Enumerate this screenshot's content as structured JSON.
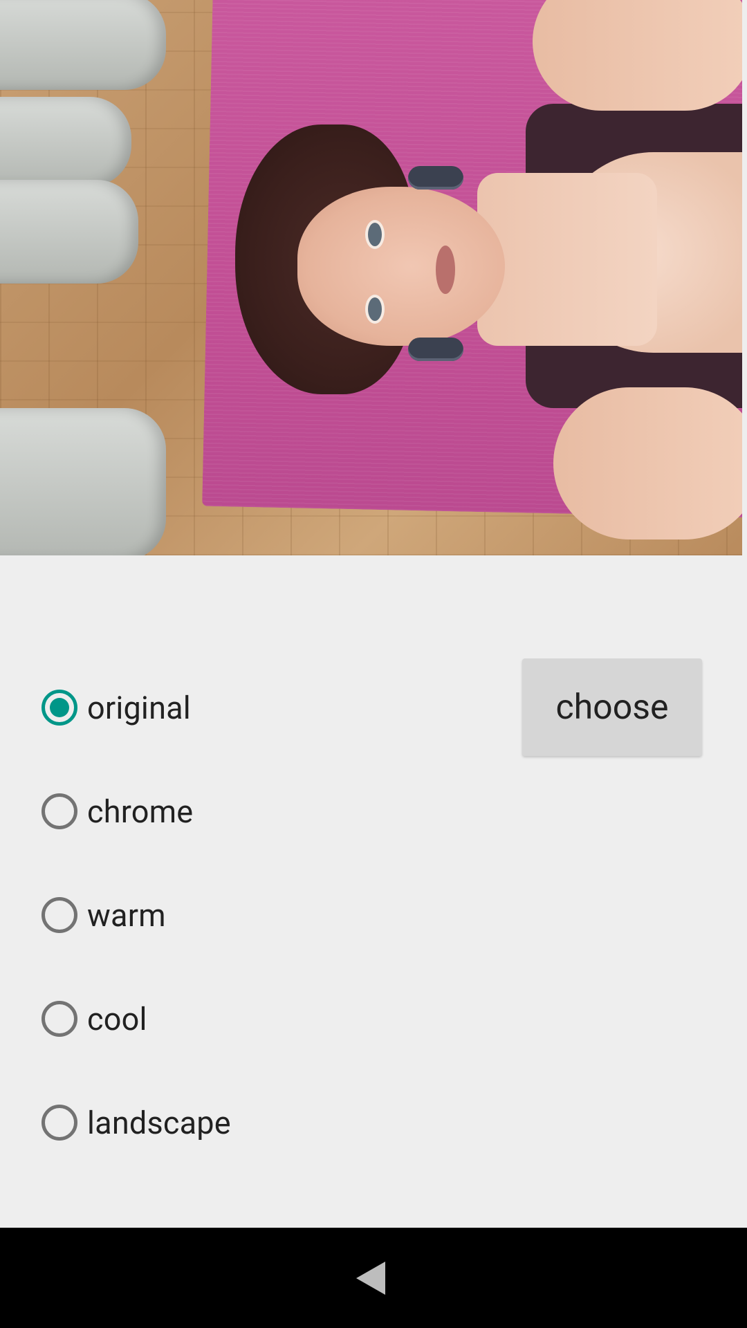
{
  "photo": {
    "alt": "selected photo preview"
  },
  "filter": {
    "options": [
      {
        "label": "original",
        "checked": true
      },
      {
        "label": "chrome",
        "checked": false
      },
      {
        "label": "warm",
        "checked": false
      },
      {
        "label": "cool",
        "checked": false
      },
      {
        "label": "landscape",
        "checked": false
      }
    ],
    "accent_color": "#009688"
  },
  "actions": {
    "choose_label": "choose"
  },
  "navigation": {
    "back_icon": "back-triangle-icon"
  }
}
